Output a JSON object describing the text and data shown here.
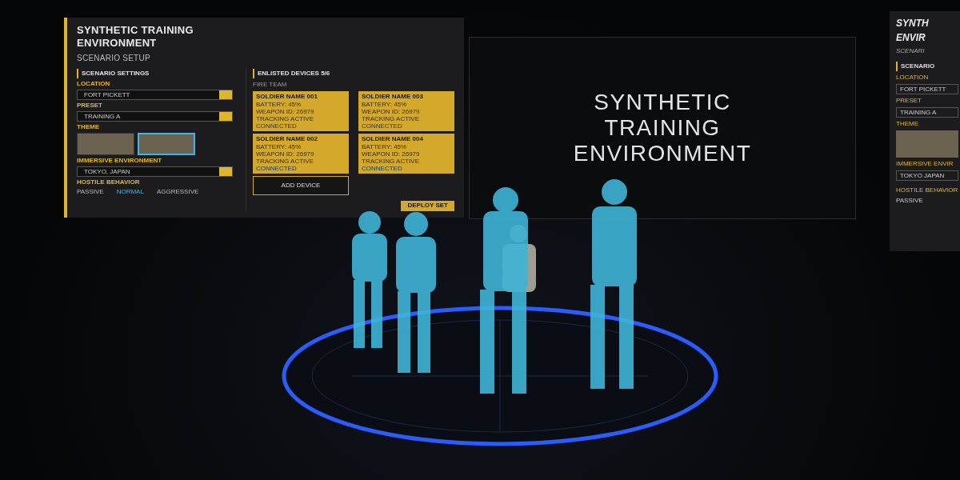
{
  "left_panel": {
    "title": "SYNTHETIC TRAINING ENVIRONMENT",
    "subtitle": "SCENARIO SETUP",
    "settings": {
      "heading": "SCENARIO SETTINGS",
      "fields": [
        {
          "label": "LOCATION",
          "value": "FORT PICKETT"
        },
        {
          "label": "PRESET",
          "value": "TRAINING A"
        }
      ],
      "theme_label": "THEME",
      "themes": [
        {
          "selected": false
        },
        {
          "selected": true
        }
      ],
      "environment": {
        "label": "IMMERSIVE ENVIRONMENT",
        "value": "TOKYO, JAPAN"
      },
      "behavior": {
        "label": "HOSTILE BEHAVIOR",
        "options": [
          {
            "label": "PASSIVE",
            "selected": false
          },
          {
            "label": "NORMAL",
            "selected": true
          },
          {
            "label": "AGGRESSIVE",
            "selected": false
          }
        ]
      }
    },
    "devices": {
      "heading": "ENLISTED DEVICES 5/6",
      "columns": [
        {
          "label": "FIRE TEAM",
          "cards": [
            {
              "name": "SOLDIER NAME 001",
              "lines": [
                "BATTERY: 45%",
                "WEAPON ID: 26979",
                "TRACKING ACTIVE"
              ],
              "status": "CONNECTED"
            },
            {
              "name": "SOLDIER NAME 002",
              "lines": [
                "BATTERY: 45%",
                "WEAPON ID: 26979",
                "TRACKING ACTIVE"
              ],
              "status": "CONNECTED"
            }
          ],
          "add_label": "ADD DEVICE"
        },
        {
          "cards": [
            {
              "name": "SOLDIER NAME 003",
              "lines": [
                "BATTERY: 45%",
                "WEAPON ID: 26979",
                "TRACKING ACTIVE"
              ],
              "status": "CONNECTED"
            },
            {
              "name": "SOLDIER NAME 004",
              "lines": [
                "BATTERY: 45%",
                "WEAPON ID: 26979",
                "TRACKING ACTIVE"
              ],
              "status": "CONNECTED"
            }
          ]
        }
      ]
    },
    "deploy_label": "DEPLOY SET"
  },
  "main_screen": {
    "title_lines": [
      "SYNTHETIC",
      "TRAINING",
      "ENVIRONMENT"
    ]
  },
  "right_panel": {
    "title_lines": [
      "SYNTH",
      "ENVIR"
    ],
    "subtitle": "SCENARI",
    "heading": "SCENARIO",
    "fields": [
      {
        "label": "LOCATION",
        "value": "FORT PICKETT"
      },
      {
        "label": "PRESET",
        "value": "TRAINING A"
      }
    ],
    "theme_label": "THEME",
    "environment": {
      "label": "IMMERSIVE ENVIR",
      "value": "TOKYO JAPAN"
    },
    "behavior": {
      "label": "HOSTILE BEHAVIOR",
      "option": "PASSIVE"
    }
  }
}
